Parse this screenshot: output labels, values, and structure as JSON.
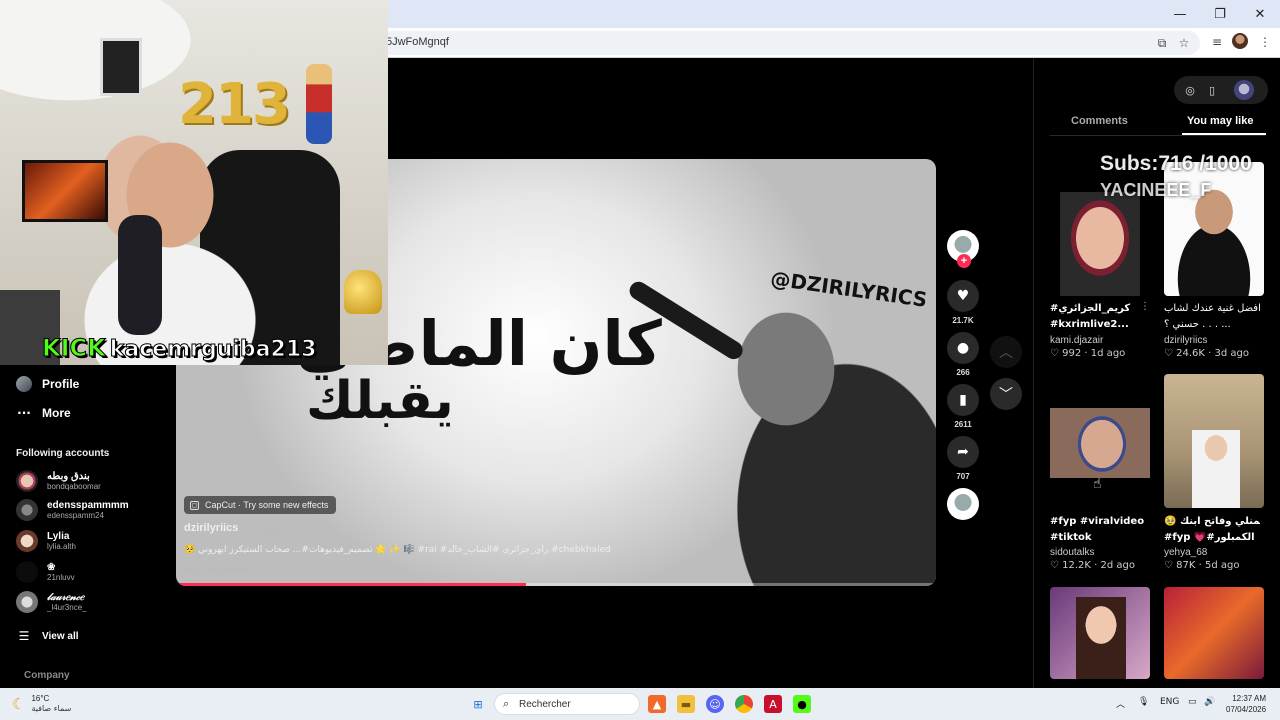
{
  "browser": {
    "url_visible": "5JwFoMgnqf",
    "window_controls": [
      "minimize",
      "restore",
      "close"
    ]
  },
  "sidebar": {
    "nav": [
      {
        "label": "Profile",
        "icon": "profile-avatar-icon"
      },
      {
        "label": "More",
        "icon": "more-dots-icon"
      }
    ],
    "following_title": "Following accounts",
    "accounts": [
      {
        "name": "بندق وبطه",
        "handle": "bondqaboomar"
      },
      {
        "name": "edensspammmm",
        "handle": "edensspamm24"
      },
      {
        "name": "Lylia",
        "handle": "lylia.alth"
      },
      {
        "name": "❀",
        "handle": "21nluvv"
      },
      {
        "name": "𝓁𝒶𝓊𝓇𝑒𝓃𝒸𝑒",
        "handle": "_l4ur3nce_"
      }
    ],
    "view_all": "View all",
    "company": "Company"
  },
  "webcam": {
    "numbers": "213",
    "brand": "KICK",
    "username": "kacemrguiba213"
  },
  "video": {
    "overlay_line1": "كان الماضي",
    "overlay_line2": "يقبلك",
    "overlay_handle": "@DZIRILYRICS",
    "capcut_label": "CapCut · Try some new effects",
    "author": "dzirilyriics",
    "date": " · 1d ago",
    "caption": "🥺 تصميم_فيديوهات#... صحاب الستيكرز ابهروني 🌟 ✨ 🎼 #rai #راي_جزائري #الشاب_خالد #chebkhaled",
    "see_translation": "See translation",
    "progress": 0.46
  },
  "actions": {
    "likes": "21.7K",
    "comments": "266",
    "saves": "2611",
    "shares": "707"
  },
  "right_panel": {
    "tabs": [
      "Comments",
      "You may like"
    ],
    "active_tab": "You may like",
    "overlay_subs": "Subs:716 /1000",
    "overlay_name": "YACINEEE_F",
    "recommendations": [
      {
        "title1": "#كريم_الجزائري",
        "title2": "#kxrimlive2...",
        "author": "kami.djazair",
        "likes": "992",
        "age": "1d ago"
      },
      {
        "title1": "افضل غنية عندك لشاب",
        "title2": "حسني ؟ . . . ...",
        "author": "dzirilyriics",
        "likes": "24.6K",
        "age": "3d ago"
      },
      {
        "title1": "#fyp #viralvideo",
        "title2": "#tiktok",
        "author": "sidoutalks",
        "likes": "12.2K",
        "age": "2d ago"
      },
      {
        "title1": "🥹 تركمنلي وفاتح ابنك",
        "title2": "#fyp 💗#الكمبلور",
        "author": "yehya_68",
        "likes": "87K",
        "age": "5d ago"
      }
    ]
  },
  "taskbar": {
    "temp": "16°C",
    "weather": "سماء صافية",
    "search": "Rechercher",
    "lang": "ENG",
    "time": "12:37 AM",
    "date": "07/04/2026"
  }
}
